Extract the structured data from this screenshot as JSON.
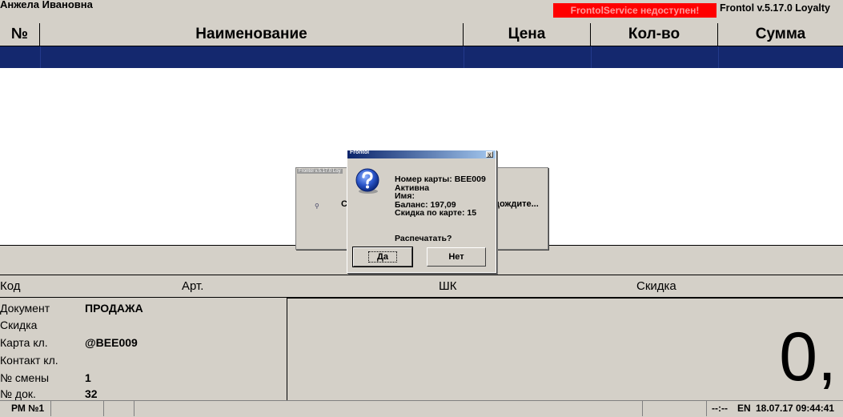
{
  "top": {
    "user": "Анжела Ивановна",
    "service_status": "FrontolService недоступен!",
    "version": "Frontol v.5.17.0 Loyalty"
  },
  "table": {
    "columns": [
      "№",
      "Наименование",
      "Цена",
      "Кол-во",
      "Сумма"
    ]
  },
  "info_header": {
    "code": "Код",
    "article": "Арт.",
    "barcode": "ШК",
    "discount": "Скидка"
  },
  "document": {
    "labels": [
      "Документ",
      "Скидка",
      "Карта кл.",
      "Контакт кл.",
      "№ смены",
      "№ док."
    ],
    "type": "ПРОДАЖА",
    "card": "@BEE009",
    "shift": "1",
    "doc_no": "32"
  },
  "total": "0,",
  "statusbar": {
    "workstation": "РМ №1",
    "clock_sep": "--:--",
    "lang": "EN",
    "datetime": "18.07.17  09:44:41"
  },
  "wait_window": {
    "title": "Frontol v.5.17.0 Loy",
    "text_left": "С",
    "text_right": "дождите..."
  },
  "dialog": {
    "title": "Frontol",
    "close": "x",
    "lines": [
      "Номер карты: BEE009",
      "Активна",
      "Имя:",
      "Баланс: 197,09",
      "Скидка по карте: 15"
    ],
    "question": "Распечатать?",
    "yes": "Да",
    "no": "Нет"
  },
  "colors": {
    "window_bg": "#d4d0c8",
    "selection": "#14286e",
    "error": "#ff0000"
  }
}
